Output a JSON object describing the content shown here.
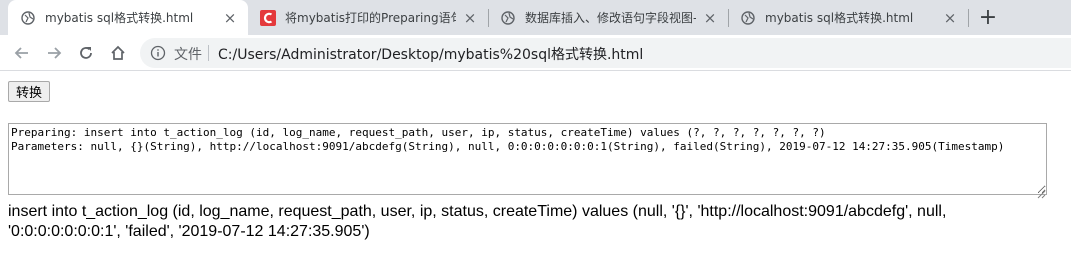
{
  "browser": {
    "tabs": [
      {
        "title": "mybatis sql格式转换.html",
        "icon": "globe-icon",
        "active": true
      },
      {
        "title": "将mybatis打印的Preparing语句",
        "icon": "csdn-icon",
        "active": false
      },
      {
        "title": "数据库插入、修改语句字段视图-",
        "icon": "globe-icon",
        "active": false
      },
      {
        "title": "mybatis sql格式转换.html",
        "icon": "globe-icon",
        "active": false
      }
    ],
    "new_tab": "+",
    "close_glyph": "×",
    "address": {
      "scheme_label": "文件",
      "url": "C:/Users/Administrator/Desktop/mybatis%20sql格式转换.html"
    }
  },
  "page": {
    "convert_label": "转换",
    "input_text": "Preparing: insert into t_action_log (id, log_name, request_path, user, ip, status, createTime) values (?, ?, ?, ?, ?, ?, ?)\nParameters: null, {}(String), http://localhost:9091/abcdefg(String), null, 0:0:0:0:0:0:0:1(String), failed(String), 2019-07-12 14:27:35.905(Timestamp)",
    "output_text": "insert into t_action_log (id, log_name, request_path, user, ip, status, createTime) values (null, '{}', 'http://localhost:9091/abcdefg', null, '0:0:0:0:0:0:0:1', 'failed', '2019-07-12 14:27:35.905')"
  },
  "colors": {
    "tabstrip": "#dee1e6",
    "csdn_red": "#e4393c",
    "omnibox": "#f1f3f4"
  }
}
